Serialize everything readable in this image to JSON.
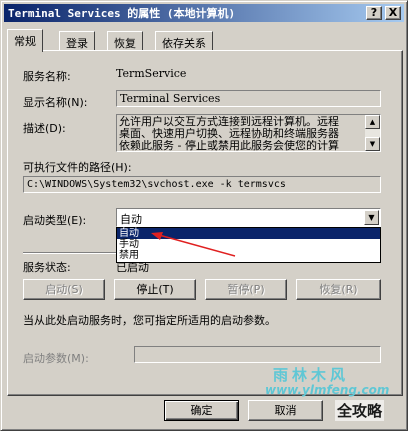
{
  "window": {
    "title": "Terminal Services 的属性 (本地计算机)",
    "help_glyph": "?",
    "close_glyph": "X"
  },
  "tabs": [
    {
      "label": "常规",
      "active": true
    },
    {
      "label": "登录",
      "active": false
    },
    {
      "label": "恢复",
      "active": false
    },
    {
      "label": "依存关系",
      "active": false
    }
  ],
  "general": {
    "service_name_label": "服务名称:",
    "service_name_value": "TermService",
    "display_name_label": "显示名称(N):",
    "display_name_value": "Terminal Services",
    "description_label": "描述(D):",
    "description_lines": [
      "允许用户以交互方式连接到远程计算机。远程",
      "桌面、快速用户切换、远程协助和终端服务器",
      "依赖此服务 - 停止或禁用此服务会使您的计算"
    ],
    "path_label": "可执行文件的路径(H):",
    "path_value": "C:\\WINDOWS\\System32\\svchost.exe -k termsvcs",
    "startup_type_label": "启动类型(E):",
    "startup_type_value": "自动",
    "startup_options": [
      "自动",
      "手动",
      "禁用"
    ],
    "status_label": "服务状态:",
    "status_value": "已启动",
    "start_button": "启动(S)",
    "stop_button": "停止(T)",
    "pause_button": "暂停(P)",
    "resume_button": "恢复(R)",
    "hint_text": "当从此处启动服务时，您可指定所适用的启动参数。",
    "params_label": "启动参数(M):",
    "params_value": ""
  },
  "footer": {
    "ok_button": "确定",
    "cancel_button": "取消"
  },
  "watermark": {
    "title": "雨林木风",
    "url": "www.ylmfeng.com",
    "slogan": "全攻略"
  },
  "colors": {
    "title_gradient_start": "#0a246a",
    "title_gradient_end": "#a6caf0",
    "selection": "#0a246a",
    "annotation_arrow": "#e02020",
    "watermark": "#5fc7d5"
  }
}
